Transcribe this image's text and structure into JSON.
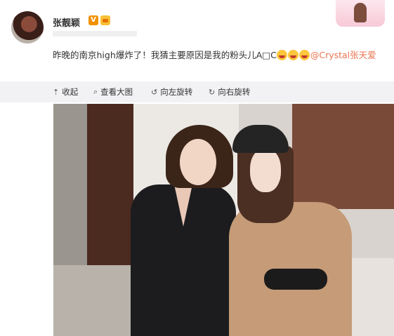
{
  "post": {
    "author": "张靓颖",
    "verified_badge": "V",
    "text_main": "昨晚的南京high爆炸了！我猜主要原因是我的粉头儿A□C",
    "mention": "@Crystal张天爱",
    "emoji_icons": [
      "laughing-emoji",
      "laughing-emoji",
      "laughing-emoji"
    ]
  },
  "toolbar": {
    "collapse_label": "收起",
    "view_large_label": "查看大图",
    "rotate_left_label": "向左旋转",
    "rotate_right_label": "向右旋转"
  },
  "colors": {
    "mention": "#eb7350",
    "toolbar_bg": "#f2f2f5",
    "verified": "#f29100"
  }
}
